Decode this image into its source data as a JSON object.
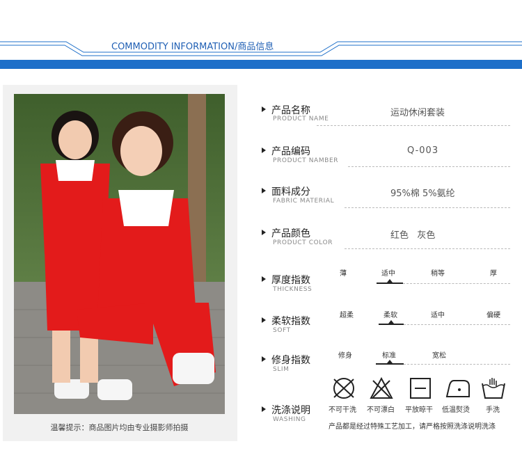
{
  "header": {
    "title": "COMMODITY INFORMATION/商品信息",
    "accent_color": "#1d6fc9"
  },
  "photo": {
    "caption": "温馨提示：商品图片均由专业摄影师拍摄"
  },
  "specs": {
    "name": {
      "label": "产品名称",
      "sub": "PRODUCT NAME",
      "value": "运动休闲套装"
    },
    "code": {
      "label": "产品编码",
      "sub": "PRODUCT NAMBER",
      "value": "Q-003"
    },
    "fabric": {
      "label": "面料成分",
      "sub": "FABRIC MATERIAL",
      "value": "95%棉 5%氨纶"
    },
    "color": {
      "label": "产品颜色",
      "sub": "PRODUCT COLOR",
      "value": "红色   灰色"
    }
  },
  "scales": {
    "thickness": {
      "label": "厚度指数",
      "sub": "THICKNESS",
      "options": [
        "薄",
        "适中",
        "稍等",
        "厚"
      ],
      "selected": "适中"
    },
    "soft": {
      "label": "柔软指数",
      "sub": "SOFT",
      "options": [
        "超柔",
        "柔软",
        "适中",
        "偏硬"
      ],
      "selected": "柔软"
    },
    "slim": {
      "label": "修身指数",
      "sub": "SLIM",
      "options": [
        "修身",
        "标准",
        "宽松"
      ],
      "selected": "标准"
    }
  },
  "washing": {
    "label": "洗涤说明",
    "sub": "WASHING",
    "icons": [
      {
        "icon": "no-tumble-dry-icon",
        "label": "不可干洗"
      },
      {
        "icon": "no-bleach-icon",
        "label": "不可漂白"
      },
      {
        "icon": "flat-dry-icon",
        "label": "平放晾干"
      },
      {
        "icon": "low-iron-icon",
        "label": "低温熨烫"
      },
      {
        "icon": "hand-wash-icon",
        "label": "手洗"
      }
    ],
    "note": "产品都是经过特殊工艺加工，请严格按照洗涤说明洗涤"
  }
}
